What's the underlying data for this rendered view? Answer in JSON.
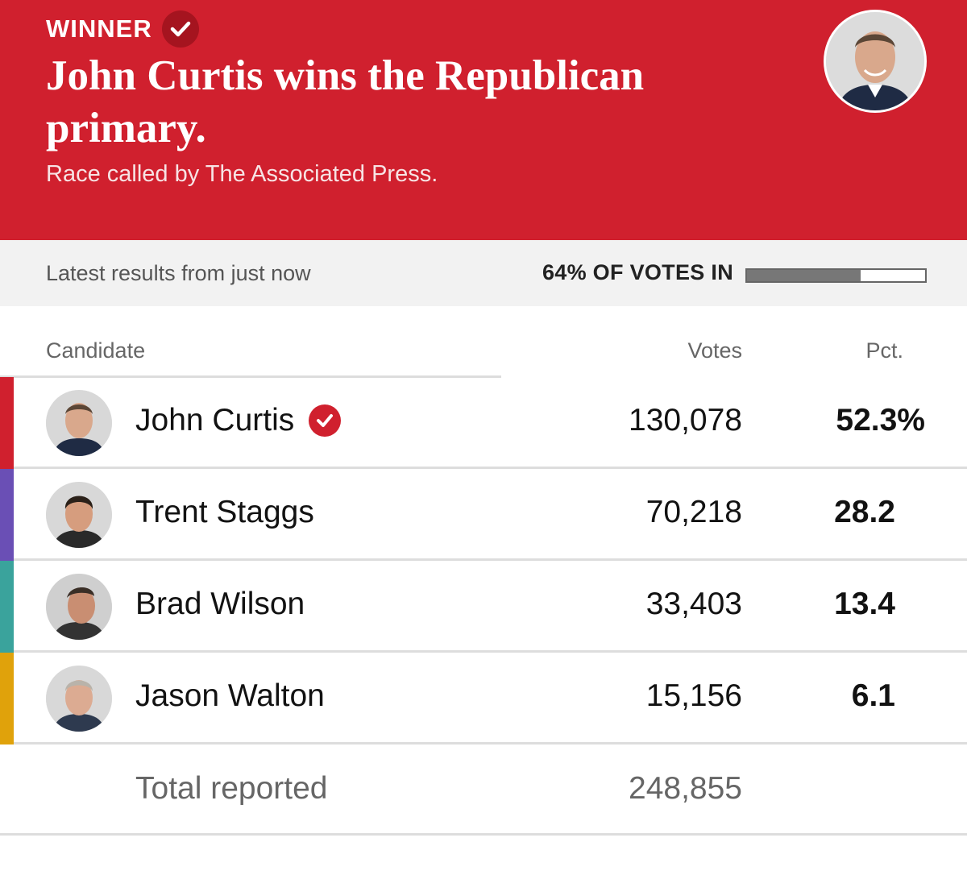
{
  "header": {
    "winner_label": "WINNER",
    "headline": "John Curtis wins the Republican primary.",
    "subhead": "Race called by The Associated Press.",
    "background_color": "#d0202e"
  },
  "status": {
    "updated_text": "Latest results from just now",
    "votes_in_label": "64% OF VOTES IN",
    "votes_in_fraction": 0.64
  },
  "table": {
    "columns": {
      "candidate": "Candidate",
      "votes": "Votes",
      "pct": "Pct."
    },
    "rows": [
      {
        "name": "John Curtis",
        "votes": "130,078",
        "pct": "52.3%",
        "winner": true,
        "color": "#d0202e"
      },
      {
        "name": "Trent Staggs",
        "votes": "70,218",
        "pct": "28.2",
        "winner": false,
        "color": "#6a4fb5"
      },
      {
        "name": "Brad Wilson",
        "votes": "33,403",
        "pct": "13.4",
        "winner": false,
        "color": "#3aa39c"
      },
      {
        "name": "Jason Walton",
        "votes": "15,156",
        "pct": "6.1",
        "winner": false,
        "color": "#e0a20b"
      }
    ],
    "total": {
      "label": "Total reported",
      "votes": "248,855"
    }
  },
  "icons": {
    "winner_check": "check-circle-icon",
    "avatar": "candidate-photo"
  }
}
